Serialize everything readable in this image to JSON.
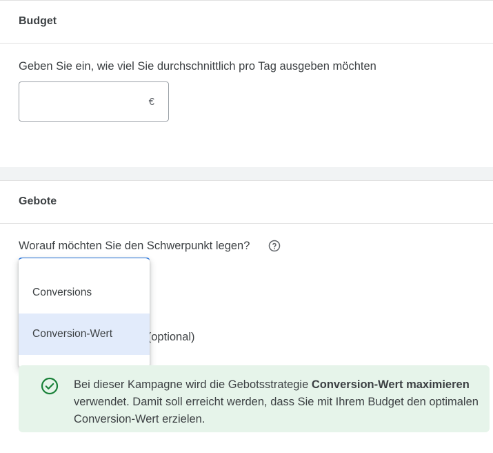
{
  "budget": {
    "title": "Budget",
    "prompt": "Geben Sie ein, wie viel Sie durchschnittlich pro Tag ausgeben möchten",
    "input_value": "",
    "currency": "€"
  },
  "bids": {
    "title": "Gebote",
    "question": "Worauf möchten Sie den Schwerpunkt legen?",
    "help_icon": "help-circle-icon",
    "partial_hidden_text": "n (optional)",
    "dropdown": {
      "options": [
        "Conversions",
        "Conversion-Wert"
      ],
      "selected": "Conversion-Wert"
    },
    "notice": {
      "icon": "check-circle-icon",
      "text_before": "Bei dieser Kampagne wird die Gebotsstrategie ",
      "text_bold": "Conversion-Wert maximieren",
      "text_after": " verwendet. Damit soll erreicht werden, dass Sie mit Ihrem Budget den optimalen Conversion-Wert erzielen."
    }
  },
  "colors": {
    "accent": "#1a73e8",
    "selected_option_bg": "#e2ebfb",
    "notice_bg": "#e6f4ea",
    "success_green": "#188038"
  }
}
